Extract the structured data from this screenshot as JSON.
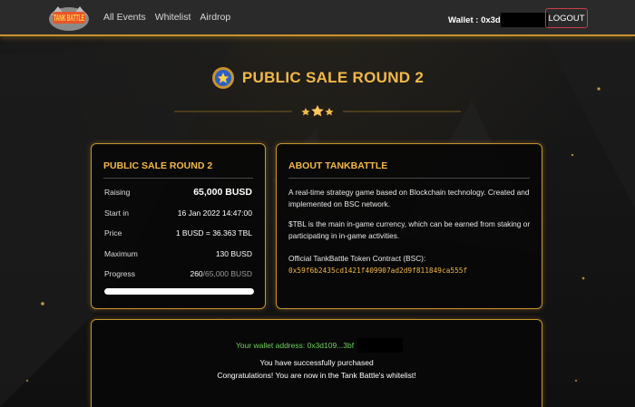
{
  "header": {
    "logo_text": "TANK BATTLE",
    "nav": [
      "All Events",
      "Whitelist",
      "Airdrop"
    ],
    "wallet_label": "Wallet : 0x3d",
    "logout_label": "LOGOUT"
  },
  "page": {
    "title": "PUBLIC SALE ROUND 2"
  },
  "sale": {
    "title": "PUBLIC SALE ROUND 2",
    "rows": [
      {
        "label": "Raising",
        "value": "65,000 BUSD"
      },
      {
        "label": "Start in",
        "value": "16 Jan 2022 14:47:00"
      },
      {
        "label": "Price",
        "value": "1 BUSD = 36.363 TBL"
      },
      {
        "label": "Maximum",
        "value": "130 BUSD"
      }
    ],
    "progress_label": "Progress",
    "progress_current": "260",
    "progress_total": "/65,000 BUSD",
    "progress_fraction": 1.0
  },
  "about": {
    "title": "ABOUT TANKBATTLE",
    "paragraph1": "A real-time strategy game based on Blockchain technology. Created and implemented on BSC network.",
    "paragraph2": "$TBL is the main in-game currency, which can be earned from staking or participating in in-game activities.",
    "contract_label": "Official TankBattle Token Contract (BSC):",
    "contract_address": "0x59f6b2435cd1421f409907ad2d9f811849ca555f"
  },
  "status": {
    "wallet_address": "Your wallet address: 0x3d109...3bf",
    "line1": "You have successfully purchased",
    "line2": "Congratulations! You are now in the Tank Battle's whitelist!"
  },
  "colors": {
    "accent": "#f2b84a",
    "border": "#c8932e",
    "success": "#6ed05a",
    "logout_border": "#c8404a"
  },
  "icons": {
    "title": "badge-star-icon",
    "divider": "three-stars-icon"
  }
}
